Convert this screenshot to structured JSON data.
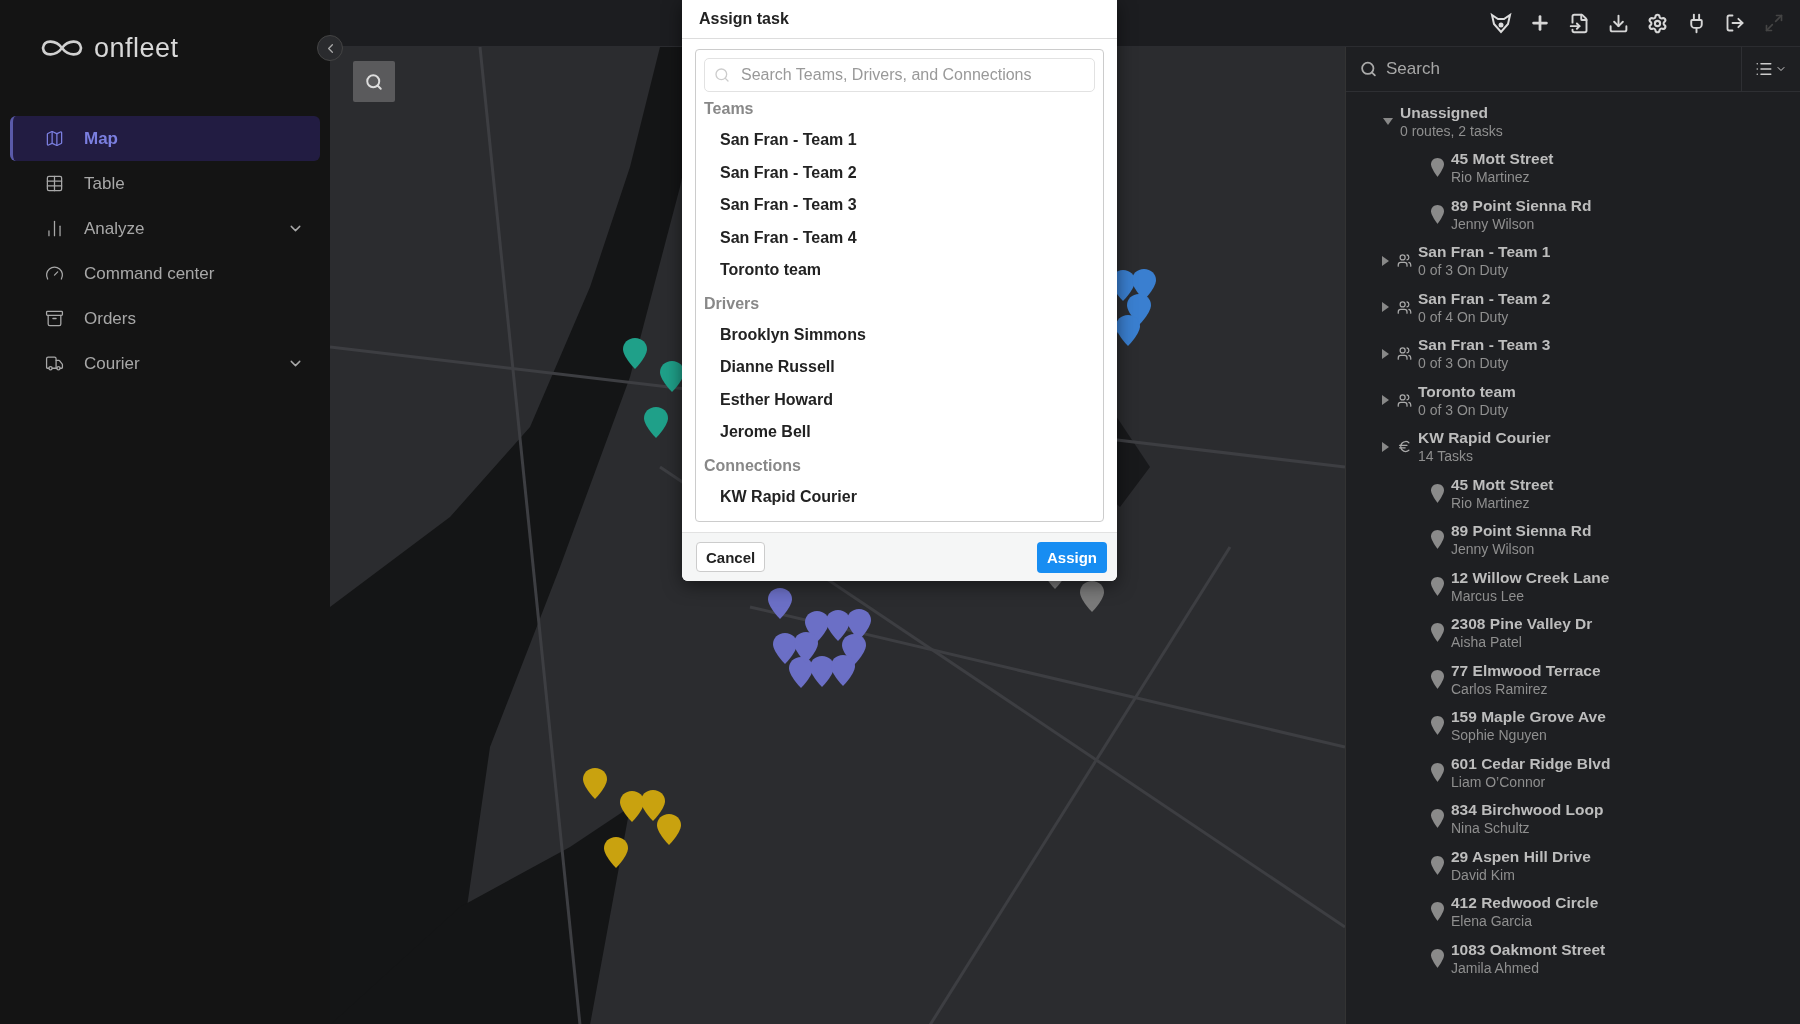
{
  "brand": {
    "name": "onfleet"
  },
  "nav": {
    "items": [
      {
        "label": "Map",
        "selected": true,
        "submenu": false
      },
      {
        "label": "Table",
        "selected": false,
        "submenu": false
      },
      {
        "label": "Analyze",
        "selected": false,
        "submenu": true
      },
      {
        "label": "Command center",
        "selected": false,
        "submenu": false
      },
      {
        "label": "Orders",
        "selected": false,
        "submenu": false
      },
      {
        "label": "Courier",
        "selected": false,
        "submenu": true
      }
    ]
  },
  "panel": {
    "search": {
      "placeholder": "Search"
    },
    "entries": [
      {
        "kind": "group",
        "title": "Unassigned",
        "subtitle": "0 routes, 2 tasks",
        "expanded": true,
        "children": [
          {
            "kind": "task",
            "title": "45 Mott Street",
            "subtitle": "Rio Martinez"
          },
          {
            "kind": "task",
            "title": "89 Point Sienna Rd",
            "subtitle": "Jenny Wilson"
          }
        ]
      },
      {
        "kind": "team",
        "title": "San Fran - Team 1",
        "subtitle": "0 of 3 On Duty",
        "expanded": false
      },
      {
        "kind": "team",
        "title": "San Fran - Team 2",
        "subtitle": "0 of 4 On Duty",
        "expanded": false
      },
      {
        "kind": "team",
        "title": "San Fran - Team 3",
        "subtitle": "0 of 3 On Duty",
        "expanded": false
      },
      {
        "kind": "team",
        "title": "Toronto team",
        "subtitle": "0 of 3 On Duty",
        "expanded": false
      },
      {
        "kind": "connection",
        "title": "KW Rapid Courier",
        "subtitle": "14 Tasks",
        "expanded": false
      },
      {
        "kind": "task",
        "title": "45 Mott Street",
        "subtitle": "Rio Martinez"
      },
      {
        "kind": "task",
        "title": "89 Point Sienna Rd",
        "subtitle": "Jenny Wilson"
      },
      {
        "kind": "task",
        "title": "12 Willow Creek Lane",
        "subtitle": "Marcus Lee"
      },
      {
        "kind": "task",
        "title": "2308 Pine Valley Dr",
        "subtitle": "Aisha Patel"
      },
      {
        "kind": "task",
        "title": "77 Elmwood Terrace",
        "subtitle": "Carlos Ramirez"
      },
      {
        "kind": "task",
        "title": "159 Maple Grove Ave",
        "subtitle": "Sophie Nguyen"
      },
      {
        "kind": "task",
        "title": "601 Cedar Ridge Blvd",
        "subtitle": "Liam O’Connor"
      },
      {
        "kind": "task",
        "title": "834 Birchwood Loop",
        "subtitle": "Nina Schultz"
      },
      {
        "kind": "task",
        "title": "29 Aspen Hill Drive",
        "subtitle": "David Kim"
      },
      {
        "kind": "task",
        "title": "412 Redwood Circle",
        "subtitle": "Elena Garcia"
      },
      {
        "kind": "task",
        "title": "1083 Oakmont Street",
        "subtitle": "Jamila Ahmed"
      }
    ]
  },
  "dialog": {
    "title": "Assign task",
    "search": {
      "placeholder": "Search Teams, Drivers, and Connections"
    },
    "sections": [
      {
        "heading": "Teams",
        "items": [
          "San Fran - Team 1",
          "San Fran - Team 2",
          "San Fran - Team 3",
          "San Fran - Team 4",
          "Toronto team"
        ]
      },
      {
        "heading": "Drivers",
        "items": [
          "Brooklyn Simmons",
          "Dianne Russell",
          "Esther Howard",
          "Jerome Bell"
        ]
      },
      {
        "heading": "Connections",
        "items": [
          "KW Rapid Courier"
        ]
      }
    ],
    "cancel": "Cancel",
    "confirm": "Assign"
  }
}
